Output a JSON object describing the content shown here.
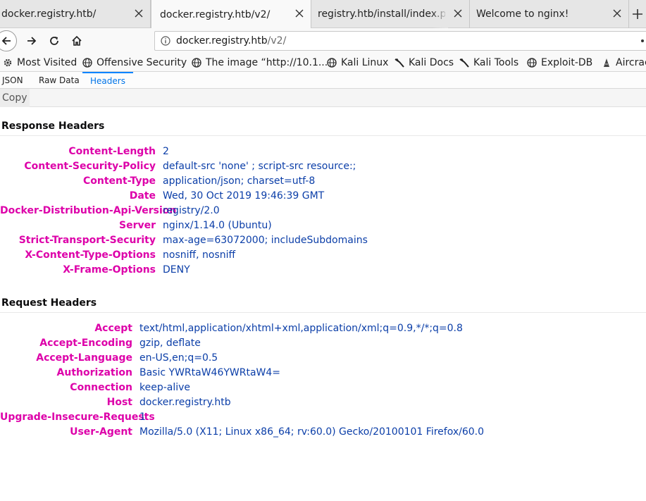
{
  "tabs": [
    {
      "title": "docker.registry.htb/",
      "active": false
    },
    {
      "title": "docker.registry.htb/v2/",
      "active": true
    },
    {
      "title": "registry.htb/install/index.php",
      "active": false
    },
    {
      "title": "Welcome to nginx!",
      "active": false
    }
  ],
  "address_bar": {
    "host": "docker.registry.htb",
    "path": "/v2/"
  },
  "bookmarks": [
    {
      "label": "Most Visited",
      "icon": "gear-icon"
    },
    {
      "label": "Offensive Security",
      "icon": "globe-icon"
    },
    {
      "label": "The image “http://10.1...",
      "icon": "globe-icon"
    },
    {
      "label": "Kali Linux",
      "icon": "globe-icon"
    },
    {
      "label": "Kali Docs",
      "icon": "kali-dragon-icon"
    },
    {
      "label": "Kali Tools",
      "icon": "kali-dragon-icon"
    },
    {
      "label": "Exploit-DB",
      "icon": "globe-icon"
    },
    {
      "label": "Aircrack",
      "icon": "aircrack-icon"
    }
  ],
  "viewer": {
    "tabs": [
      "JSON",
      "Raw Data",
      "Headers"
    ],
    "active_tab": "Headers",
    "copy_label": "Copy"
  },
  "response_headers": {
    "title": "Response Headers",
    "rows": [
      {
        "name": "Content-Length",
        "value": "2"
      },
      {
        "name": "Content-Security-Policy",
        "value": "default-src 'none' ; script-src resource:;"
      },
      {
        "name": "Content-Type",
        "value": "application/json; charset=utf-8"
      },
      {
        "name": "Date",
        "value": "Wed, 30 Oct 2019 19:46:39 GMT"
      },
      {
        "name": "Docker-Distribution-Api-Version",
        "value": "registry/2.0"
      },
      {
        "name": "Server",
        "value": "nginx/1.14.0 (Ubuntu)"
      },
      {
        "name": "Strict-Transport-Security",
        "value": "max-age=63072000; includeSubdomains"
      },
      {
        "name": "X-Content-Type-Options",
        "value": "nosniff, nosniff"
      },
      {
        "name": "X-Frame-Options",
        "value": "DENY"
      }
    ]
  },
  "request_headers": {
    "title": "Request Headers",
    "rows": [
      {
        "name": "Accept",
        "value": "text/html,application/xhtml+xml,application/xml;q=0.9,*/*;q=0.8"
      },
      {
        "name": "Accept-Encoding",
        "value": "gzip, deflate"
      },
      {
        "name": "Accept-Language",
        "value": "en-US,en;q=0.5"
      },
      {
        "name": "Authorization",
        "value": "Basic YWRtaW46YWRtaW4="
      },
      {
        "name": "Connection",
        "value": "keep-alive"
      },
      {
        "name": "Host",
        "value": "docker.registry.htb"
      },
      {
        "name": "Upgrade-Insecure-Requests",
        "value": "1"
      },
      {
        "name": "User-Agent",
        "value": "Mozilla/5.0 (X11; Linux x86_64; rv:60.0) Gecko/20100101 Firefox/60.0"
      }
    ]
  },
  "colors": {
    "header_name": "#dd00a9",
    "header_value": "#0b3ea8",
    "active_tab_accent": "#0a84ff"
  }
}
